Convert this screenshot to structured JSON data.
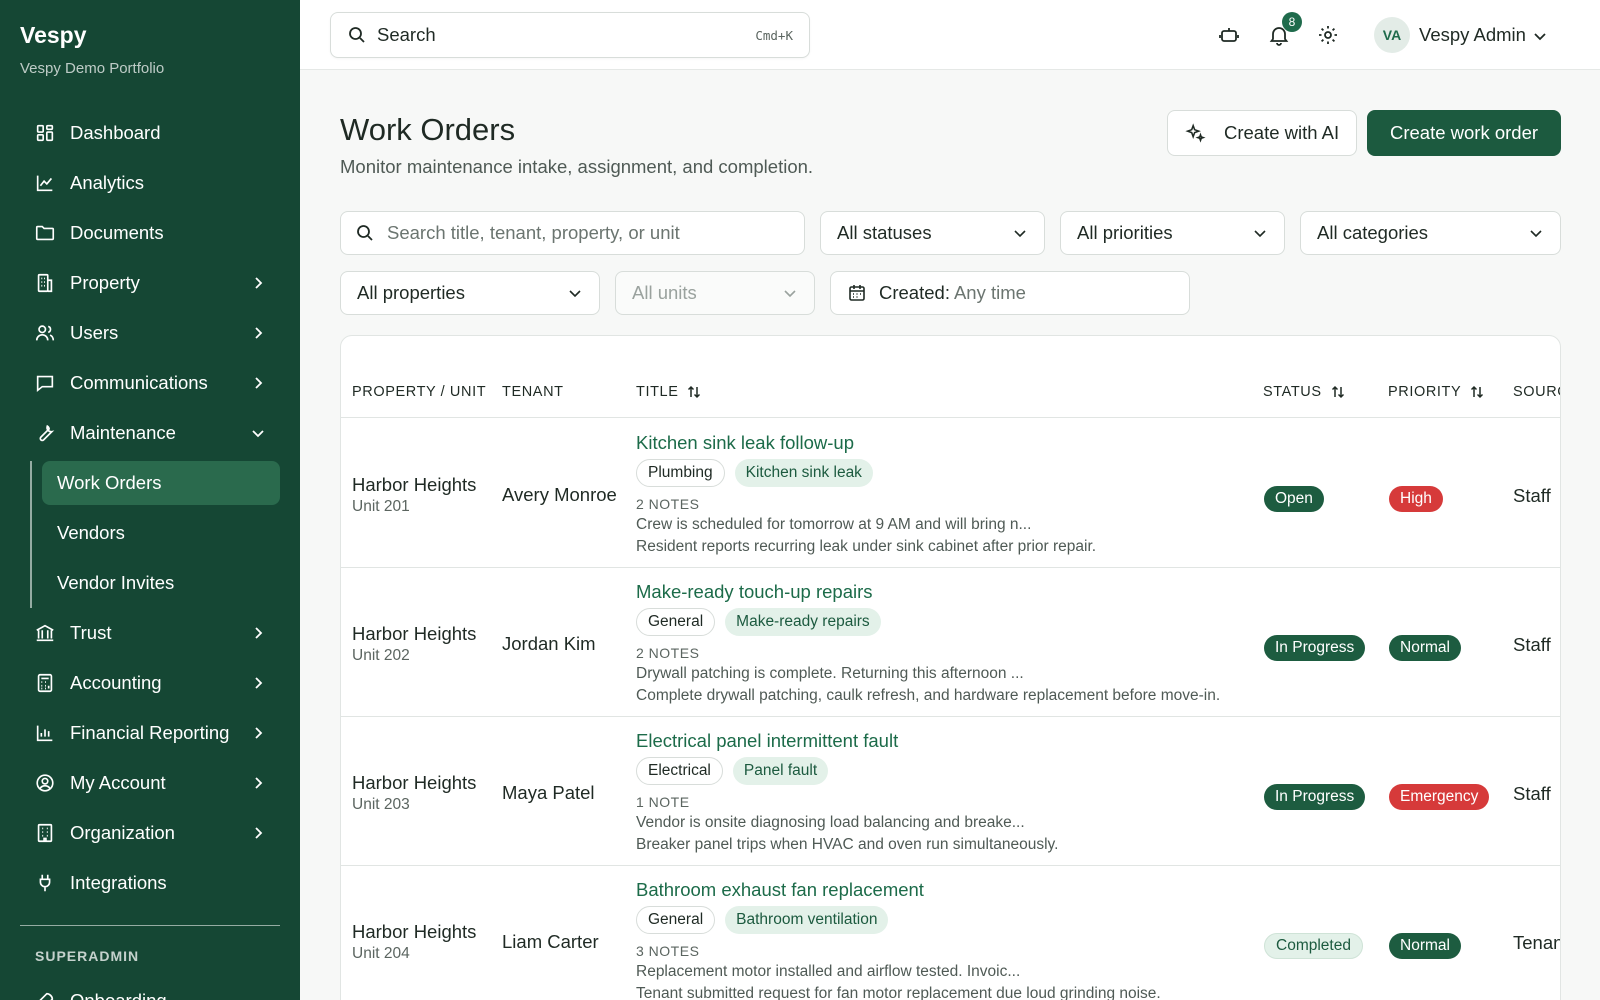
{
  "colors": {
    "sidebar": "#154734",
    "accent": "#1c5a3f",
    "open": "#1d5c40",
    "in_progress": "#1d5c40",
    "completed_bg": "#e3f1e9",
    "completed_fg": "#1c5a3f",
    "high": "#d63a3a",
    "emergency": "#d63a3a",
    "normal": "#1d5c40"
  },
  "brand": {
    "name": "Vespy",
    "subtitle": "Vespy Demo Portfolio"
  },
  "sidebar": {
    "items": [
      {
        "label": "Dashboard",
        "icon": "dashboard-icon"
      },
      {
        "label": "Analytics",
        "icon": "chart-line-icon"
      },
      {
        "label": "Documents",
        "icon": "folder-icon"
      },
      {
        "label": "Property",
        "icon": "building-icon"
      },
      {
        "label": "Users",
        "icon": "users-icon"
      },
      {
        "label": "Communications",
        "icon": "message-icon"
      },
      {
        "label": "Maintenance",
        "icon": "wrench-icon"
      }
    ],
    "maintenance_sub": [
      {
        "label": "Work Orders",
        "active": true
      },
      {
        "label": "Vendors"
      },
      {
        "label": "Vendor Invites"
      }
    ],
    "items_after": [
      {
        "label": "Trust",
        "icon": "bank-icon"
      },
      {
        "label": "Accounting",
        "icon": "calculator-icon"
      },
      {
        "label": "Financial Reporting",
        "icon": "bar-chart-icon"
      },
      {
        "label": "My Account",
        "icon": "user-circle-icon"
      },
      {
        "label": "Organization",
        "icon": "office-icon"
      },
      {
        "label": "Integrations",
        "icon": "plug-icon"
      }
    ],
    "section_label": "SUPERADMIN",
    "onboarding": "Onboarding"
  },
  "topbar": {
    "search_label": "Search",
    "search_shortcut": "Cmd+K",
    "notifications_count": "8",
    "user_initials": "VA",
    "user_name": "Vespy Admin"
  },
  "page": {
    "title": "Work Orders",
    "subtitle": "Monitor maintenance intake, assignment, and completion.",
    "create_ai_label": "Create with AI",
    "create_label": "Create work order"
  },
  "filters": {
    "search_placeholder": "Search title, tenant, property, or unit",
    "status": "All statuses",
    "priority": "All priorities",
    "category": "All categories",
    "property": "All properties",
    "unit": "All units",
    "created_key": "Created:",
    "created_value": "Any time"
  },
  "table": {
    "headers": {
      "property": "PROPERTY / UNIT",
      "tenant": "TENANT",
      "title": "TITLE",
      "status": "STATUS",
      "priority": "PRIORITY",
      "source": "SOURCE"
    },
    "rows": [
      {
        "property": "Harbor Heights",
        "unit": "Unit 201",
        "tenant": "Avery Monroe",
        "title": "Kitchen sink leak follow-up",
        "category": "Plumbing",
        "subcategory": "Kitchen sink leak",
        "notes_count": "2 NOTES",
        "note": "Crew is scheduled for tomorrow at 9 AM and will bring n...",
        "description": "Resident reports recurring leak under sink cabinet after prior repair.",
        "status": "Open",
        "priority": "High",
        "source": "Staff"
      },
      {
        "property": "Harbor Heights",
        "unit": "Unit 202",
        "tenant": "Jordan Kim",
        "title": "Make-ready touch-up repairs",
        "category": "General",
        "subcategory": "Make-ready repairs",
        "notes_count": "2 NOTES",
        "note": "Drywall patching is complete. Returning this afternoon ...",
        "description": "Complete drywall patching, caulk refresh, and hardware replacement before move-in.",
        "status": "In Progress",
        "priority": "Normal",
        "source": "Staff"
      },
      {
        "property": "Harbor Heights",
        "unit": "Unit 203",
        "tenant": "Maya Patel",
        "title": "Electrical panel intermittent fault",
        "category": "Electrical",
        "subcategory": "Panel fault",
        "notes_count": "1 NOTE",
        "note": "Vendor is onsite diagnosing load balancing and breake...",
        "description": "Breaker panel trips when HVAC and oven run simultaneously.",
        "status": "In Progress",
        "priority": "Emergency",
        "source": "Staff"
      },
      {
        "property": "Harbor Heights",
        "unit": "Unit 204",
        "tenant": "Liam Carter",
        "title": "Bathroom exhaust fan replacement",
        "category": "General",
        "subcategory": "Bathroom ventilation",
        "notes_count": "3 NOTES",
        "note": "Replacement motor installed and airflow tested. Invoic...",
        "description": "Tenant submitted request for fan motor replacement due loud grinding noise.",
        "status": "Completed",
        "priority": "Normal",
        "source": "Tenant"
      }
    ]
  }
}
